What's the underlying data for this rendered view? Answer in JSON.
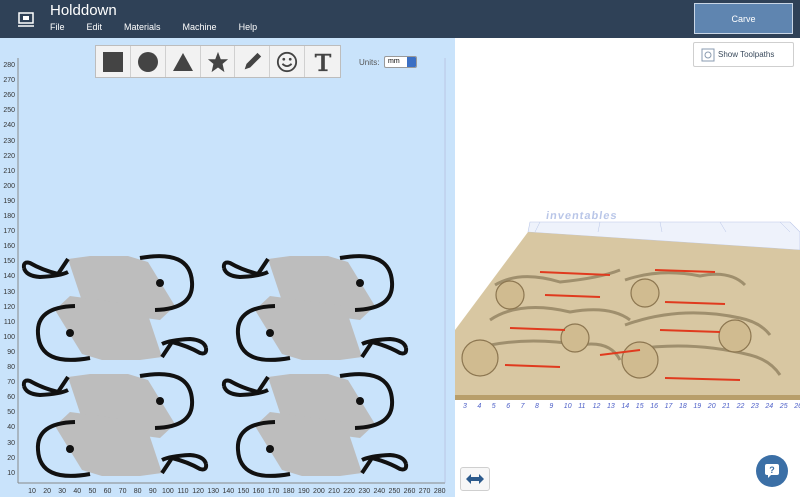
{
  "app": {
    "title": "Holddown"
  },
  "menu": [
    "File",
    "Edit",
    "Materials",
    "Machine",
    "Help"
  ],
  "carve_button": "Carve",
  "show_toolpaths": "Show Toolpaths",
  "units": {
    "label": "Units:",
    "value": "mm"
  },
  "toolbar": [
    "square-tool",
    "circle-tool",
    "triangle-tool",
    "star-tool",
    "pencil-tool",
    "smiley-tool",
    "text-tool"
  ],
  "axis": {
    "y": [
      "280",
      "270",
      "260",
      "250",
      "240",
      "230",
      "220",
      "210",
      "200",
      "190",
      "180",
      "170",
      "160",
      "150",
      "140",
      "130",
      "120",
      "110",
      "100",
      "90",
      "80",
      "70",
      "60",
      "50",
      "40",
      "30",
      "20",
      "10"
    ],
    "x": [
      "10",
      "20",
      "30",
      "40",
      "50",
      "60",
      "70",
      "80",
      "90",
      "100",
      "110",
      "120",
      "130",
      "140",
      "150",
      "160",
      "170",
      "180",
      "190",
      "200",
      "210",
      "220",
      "230",
      "240",
      "250",
      "260",
      "270",
      "280"
    ]
  },
  "preview": {
    "brand": "inventables",
    "ruler": [
      "3",
      "4",
      "5",
      "6",
      "7",
      "8",
      "9",
      "10",
      "11",
      "12",
      "13",
      "14",
      "15",
      "16",
      "17",
      "18",
      "19",
      "20",
      "21",
      "22",
      "23",
      "24",
      "25",
      "26"
    ]
  },
  "colors": {
    "topbar": "#2f4157",
    "accent": "#5f85b0",
    "canvas": "#c9e3fb",
    "wood": "#d8c7a2",
    "cut": "#e03a1e"
  }
}
